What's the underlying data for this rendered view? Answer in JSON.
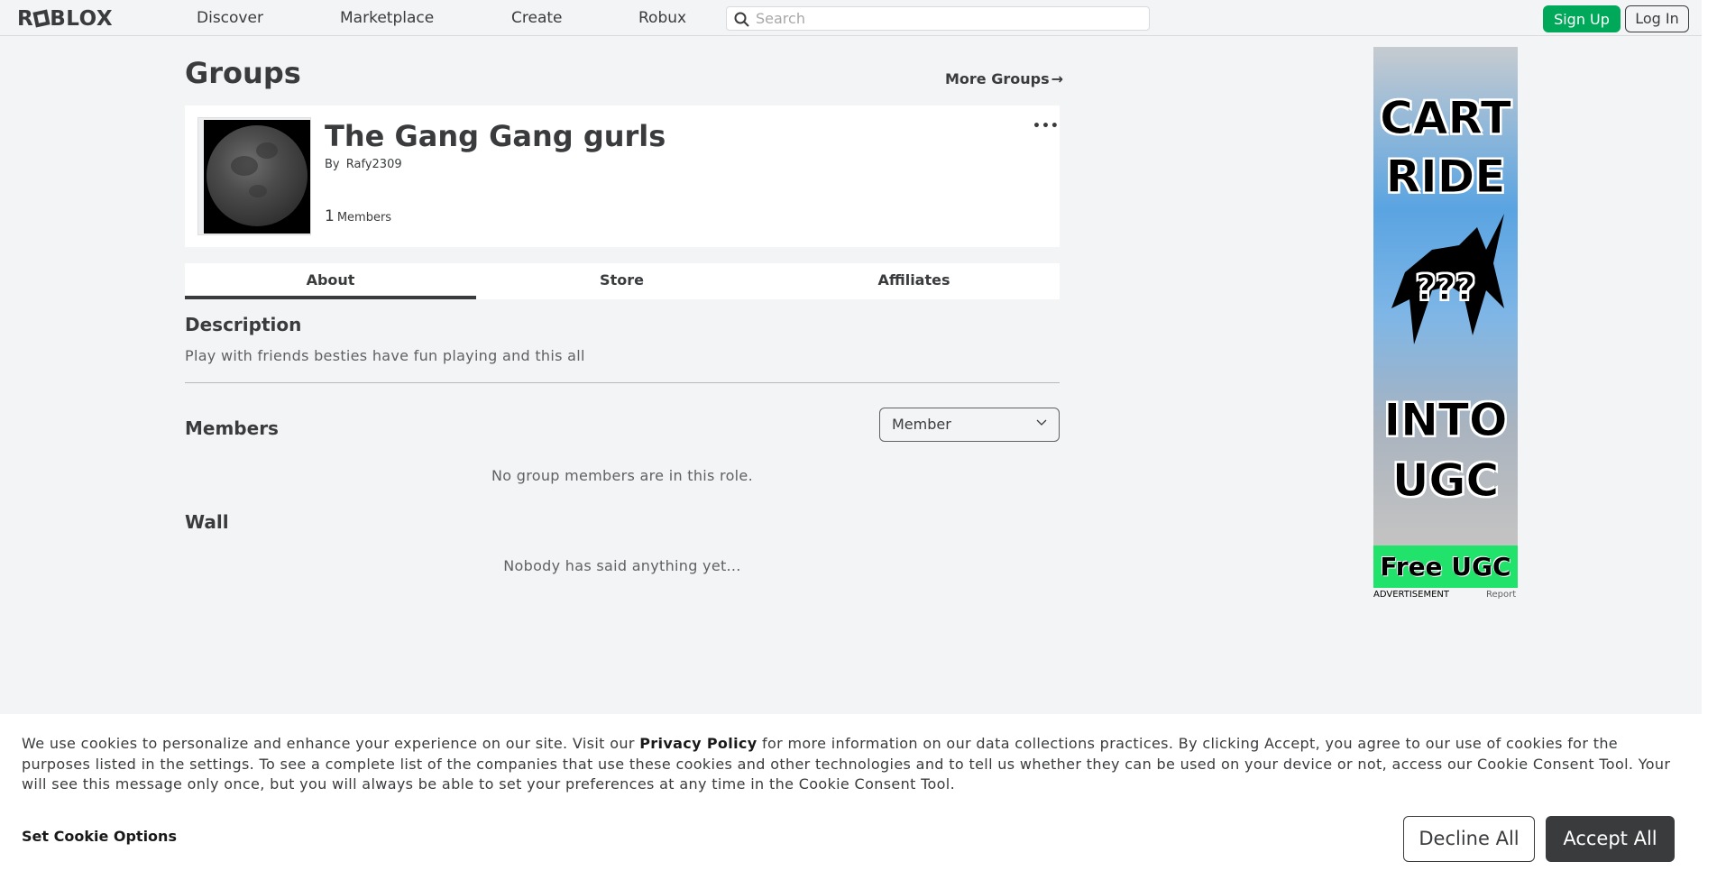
{
  "nav": {
    "logo": "ROBLOX",
    "links": [
      "Discover",
      "Marketplace",
      "Create",
      "Robux"
    ],
    "search_placeholder": "Search",
    "signup": "Sign Up",
    "login": "Log In"
  },
  "page": {
    "title": "Groups",
    "more_groups": "More Groups"
  },
  "group": {
    "name": "The Gang Gang gurls",
    "by_label": "By",
    "owner": "Rafy2309",
    "member_count": "1",
    "members_label": "Members",
    "more_menu": "•••"
  },
  "tabs": [
    "About",
    "Store",
    "Affiliates"
  ],
  "about": {
    "description_title": "Description",
    "description": "Play with friends besties have fun playing and this all",
    "members_title": "Members",
    "role_selected": "Member",
    "members_empty": "No group members are in this role.",
    "wall_title": "Wall",
    "wall_empty": "Nobody has said anything yet..."
  },
  "ad": {
    "lines": [
      "CART",
      "RIDE",
      "???",
      "INTO",
      "UGC"
    ],
    "banner": "Free UGC !",
    "label": "ADVERTISEMENT",
    "report": "Report"
  },
  "cookie": {
    "text_before": "We use cookies to personalize and enhance your experience on our site. Visit our ",
    "privacy_link": "Privacy Policy",
    "text_after": " for more information on our data collections practices. By clicking Accept, you agree to our use of cookies for the purposes listed in the settings. To see a complete list of the companies that use these cookies and other technologies and to tell us whether they can be used on your device or not, access our Cookie Consent Tool. Your will see this message only once, but you will always be able to set your preferences at any time in the Cookie Consent Tool.",
    "set_options": "Set Cookie Options",
    "decline": "Decline All",
    "accept": "Accept All"
  }
}
